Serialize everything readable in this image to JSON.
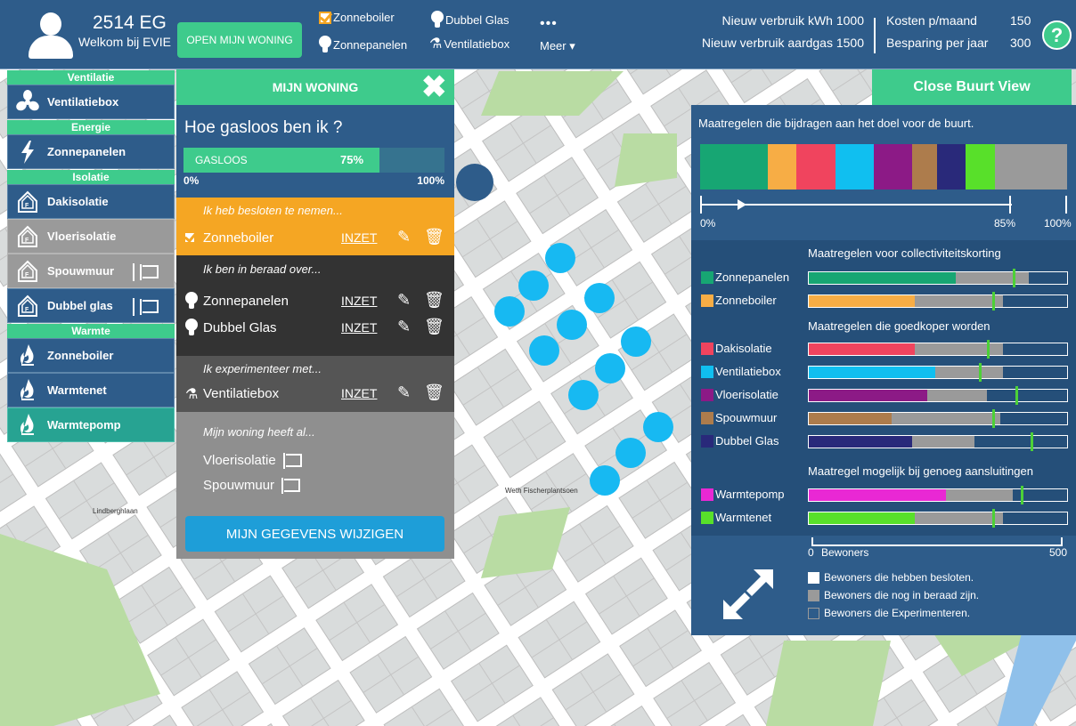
{
  "header": {
    "postcode": "2514 EG",
    "welcome": "Welkom bij EVIE",
    "open_button": "OPEN MIJN WONING",
    "measures": [
      {
        "label": "Zonneboiler",
        "icon": "checkbox-icon"
      },
      {
        "label": "Zonnepanelen",
        "icon": "lightbulb-icon"
      },
      {
        "label": "Dubbel Glas",
        "icon": "lightbulb-icon"
      },
      {
        "label": "Ventilatiebox",
        "icon": "flask-icon"
      }
    ],
    "more_label": "Meer ▾",
    "stats": {
      "kwh_label": "Nieuw verbruik kWh 1000",
      "gas_label": "Nieuw verbruik aardgas 1500",
      "costs_label": "Kosten p/maand",
      "costs_value": "150",
      "savings_label": "Besparing per jaar",
      "savings_value": "300"
    },
    "help": "?"
  },
  "sidebar": {
    "categories": [
      {
        "title": "Ventilatie",
        "items": [
          {
            "label": "Ventilatiebox",
            "icon": "fan-icon",
            "style": "blue",
            "flag": false
          }
        ]
      },
      {
        "title": "Energie",
        "items": [
          {
            "label": "Zonnepanelen",
            "icon": "lightning-icon",
            "style": "blue",
            "flag": false
          }
        ]
      },
      {
        "title": "Isolatie",
        "items": [
          {
            "label": "Dakisolatie",
            "icon": "house-icon",
            "style": "blue",
            "flag": false
          },
          {
            "label": "Vloerisolatie",
            "icon": "house-icon",
            "style": "gray",
            "flag": false
          },
          {
            "label": "Spouwmuur",
            "icon": "house-icon",
            "style": "gray",
            "flag": true
          },
          {
            "label": "Dubbel glas",
            "icon": "house-icon",
            "style": "blue",
            "flag": true
          }
        ]
      },
      {
        "title": "Warmte",
        "items": [
          {
            "label": "Zonneboiler",
            "icon": "flame-icon",
            "style": "blue",
            "flag": false
          },
          {
            "label": "Warmtenet",
            "icon": "flame-icon",
            "style": "blue",
            "flag": false
          },
          {
            "label": "Warmtepomp",
            "icon": "flame-icon",
            "style": "teal",
            "flag": false
          }
        ]
      }
    ]
  },
  "mijn_woning": {
    "header": "MIJN WONING",
    "title": "Hoe gasloos ben ik ?",
    "gasloos_label": "GASLOOS",
    "gasloos_value": 0.75,
    "gasloos_pct": "75%",
    "min_label": "0%",
    "max_label": "100%",
    "sections": {
      "besloten": "Ik heb besloten te nemen...",
      "beraad": "Ik ben in beraad over...",
      "experiment": "Ik experimenteer met...",
      "al": "Mijn woning heeft al..."
    },
    "inzet_label": "INZET",
    "besloten_items": [
      "Zonneboiler"
    ],
    "beraad_items": [
      "Zonnepanelen",
      "Dubbel Glas"
    ],
    "experiment_items": [
      "Ventilatiebox"
    ],
    "al_items": [
      "Vloerisolatie",
      "Spouwmuur"
    ],
    "button": "MIJN GEGEVENS WIJZIGEN"
  },
  "buurt": {
    "close_button": "Close Buurt View",
    "title": "Maatregelen die bijdragen aan het doel voor de buurt.",
    "stack": [
      {
        "color": "#17a673",
        "value": 14
      },
      {
        "color": "#f7ad45",
        "value": 6
      },
      {
        "color": "#f0445e",
        "value": 8
      },
      {
        "color": "#10bff0",
        "value": 8
      },
      {
        "color": "#8c1a86",
        "value": 8
      },
      {
        "color": "#ad7c4c",
        "value": 5
      },
      {
        "color": "#29297a",
        "value": 6
      },
      {
        "color": "#58e02a",
        "value": 6
      },
      {
        "color": "#9a9a9a",
        "value": 15
      }
    ],
    "progress": {
      "start": "0%",
      "mark": "85%",
      "end": "100%"
    },
    "groups": [
      {
        "title": "Maatregelen voor collectiviteitskorting",
        "rows": [
          {
            "name": "Zonnepanelen",
            "color": "#17a673",
            "besloten": 0.57,
            "beraad": 0.85,
            "marker": 0.79
          },
          {
            "name": "Zonneboiler",
            "color": "#f7ad45",
            "besloten": 0.41,
            "beraad": 0.75,
            "marker": 0.71
          }
        ]
      },
      {
        "title": "Maatregelen die goedkoper worden",
        "rows": [
          {
            "name": "Dakisolatie",
            "color": "#f0445e",
            "besloten": 0.41,
            "beraad": 0.75,
            "marker": 0.69
          },
          {
            "name": "Ventilatiebox",
            "color": "#10bff0",
            "besloten": 0.49,
            "beraad": 0.75,
            "marker": 0.66
          },
          {
            "name": "Vloerisolatie",
            "color": "#8c1a86",
            "besloten": 0.46,
            "beraad": 0.69,
            "marker": 0.8
          },
          {
            "name": "Spouwmuur",
            "color": "#ad7c4c",
            "besloten": 0.32,
            "beraad": 0.74,
            "marker": 0.71
          },
          {
            "name": "Dubbel Glas",
            "color": "#29297a",
            "besloten": 0.4,
            "beraad": 0.64,
            "marker": 0.86
          }
        ]
      },
      {
        "title": "Maatregel mogelijk bij genoeg aansluitingen",
        "rows": [
          {
            "name": "Warmtepomp",
            "color": "#e928d4",
            "besloten": 0.53,
            "beraad": 0.79,
            "marker": 0.82
          },
          {
            "name": "Warmtenet",
            "color": "#58e02a",
            "besloten": 0.41,
            "beraad": 0.75,
            "marker": 0.71
          }
        ]
      }
    ],
    "axis": {
      "min": "0",
      "label": "Bewoners",
      "max": "500"
    },
    "legend": [
      {
        "label": "Bewoners die hebben besloten.",
        "swatch": "#ffffff"
      },
      {
        "label": "Bewoners die nog in beraad zijn.",
        "swatch": "#9a9a9a"
      },
      {
        "label": "Bewoners die Experimenteren.",
        "swatch": "outline"
      }
    ]
  },
  "map": {
    "labels": [
      "Weth Fischerplantsoen",
      "Lindberghlaan"
    ]
  }
}
